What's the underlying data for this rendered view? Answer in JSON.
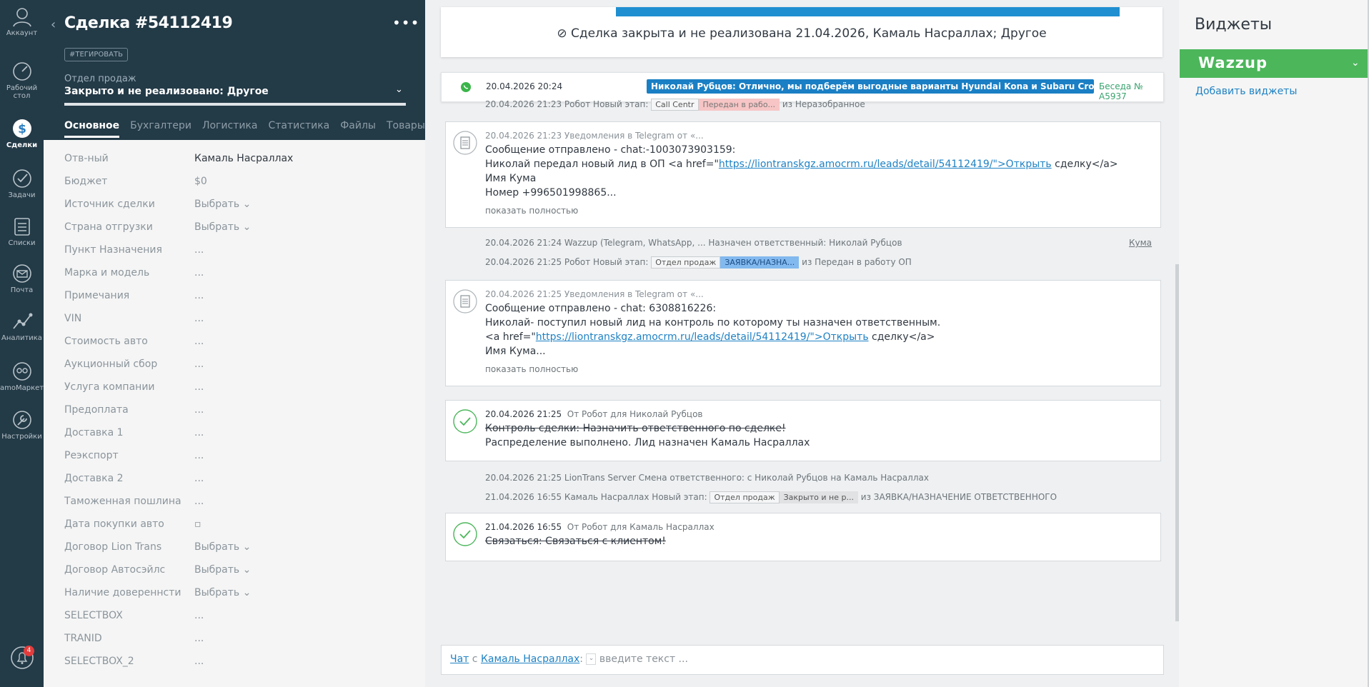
{
  "nav": {
    "items": [
      {
        "label": "Аккаунт",
        "icon": "account-icon"
      },
      {
        "label": "Рабочий стол",
        "icon": "dashboard-icon"
      },
      {
        "label": "Сделки",
        "icon": "deals-icon"
      },
      {
        "label": "Задачи",
        "icon": "tasks-icon"
      },
      {
        "label": "Списки",
        "icon": "lists-icon"
      },
      {
        "label": "Почта",
        "icon": "mail-icon"
      },
      {
        "label": "Аналитика",
        "icon": "analytics-icon"
      },
      {
        "label": "amoМаркет",
        "icon": "market-icon"
      },
      {
        "label": "Настройки",
        "icon": "settings-icon"
      }
    ],
    "notifications_count": "4"
  },
  "card": {
    "title": "Сделка #54112419",
    "tag_button": "#ТЕГИРОВАТЬ",
    "pipeline": "Отдел продаж",
    "status": "Закрыто и не реализовано: Другое",
    "tabs": [
      "Основное",
      "Бухгалтери",
      "Логистика",
      "Статистика",
      "Файлы",
      "Товары",
      "···"
    ],
    "fields": [
      {
        "label": "Отв-ный",
        "value": "Камаль Насраллах"
      },
      {
        "label": "Бюджет",
        "value": "$0"
      },
      {
        "label": "Источник сделки",
        "value": "Выбрать ⌄"
      },
      {
        "label": "Страна отгрузки",
        "value": "Выбрать ⌄"
      },
      {
        "label": "Пункт Назначения",
        "value": "..."
      },
      {
        "label": "Марка и модель",
        "value": "..."
      },
      {
        "label": "Примечания",
        "value": "..."
      },
      {
        "label": "VIN",
        "value": "..."
      },
      {
        "label": "Стоимость авто",
        "value": "..."
      },
      {
        "label": "Аукционный сбор",
        "value": "..."
      },
      {
        "label": "Услуга компании",
        "value": "..."
      },
      {
        "label": "Предоплата",
        "value": "..."
      },
      {
        "label": "Доставка 1",
        "value": "..."
      },
      {
        "label": "Реэкспорт",
        "value": "..."
      },
      {
        "label": "Доставка 2",
        "value": "..."
      },
      {
        "label": "Таможенная пошлина",
        "value": "..."
      },
      {
        "label": "Дата покупки авто",
        "value": "▫"
      },
      {
        "label": "Договор Lion Trans",
        "value": "Выбрать ⌄"
      },
      {
        "label": "Договор Автосэйлс",
        "value": "Выбрать ⌄"
      },
      {
        "label": "Наличие довереннсти",
        "value": "Выбрать ⌄"
      },
      {
        "label": "SELECTBOX",
        "value": "..."
      },
      {
        "label": "TRANID",
        "value": "..."
      },
      {
        "label": "SELECTBOX_2",
        "value": "..."
      }
    ]
  },
  "feed": {
    "closed_banner": "⊘  Сделка закрыта и не реализована 21.04.2026, Камаль Насраллах; Другое",
    "whatsapp": {
      "time": "20.04.2026 20:24",
      "message": "Николай Рубцов: Отличнo, мы подберём выгодные варианты Hyundai Kona и Subaru Crosstrek не старше ...",
      "conversation": "Беседа № A5937"
    },
    "sys1": {
      "text": "20.04.2026 21:23 Робот Новый этап:",
      "pill1": "Call Centr",
      "pill2": "Передан в рабо...",
      "suffix": "из Неразобранное"
    },
    "note1": {
      "meta": "20.04.2026 21:23 Уведомления в Telegram от «...",
      "l1": "Сообщение отправлено - chat:-1003073903159:",
      "l2_a": "Николай передал новый лид в ОП <a href=\"",
      "l2_link": "https://liontranskgz.amocrm.ru/leads/detail/54112419/\">Открыть",
      "l2_b": " сделку</a>",
      "l3": "Имя Кума",
      "l4": "Номер +996501998865...",
      "more": "показать полностью"
    },
    "sys2": {
      "text": "20.04.2026 21:24 Wazzup (Telegram, WhatsApp, ... Назначен ответственный: Николай Рубцов",
      "right": "Кума"
    },
    "sys3": {
      "text": "20.04.2026 21:25 Робот Новый этап:",
      "pill1": "Отдел продаж",
      "pill2": "ЗАЯВКА/НАЗНА...",
      "suffix": "из Передан в работу ОП"
    },
    "note2": {
      "meta": "20.04.2026 21:25 Уведомления в Telegram от «...",
      "l1": "Сообщение отправлено - chat: 6308816226:",
      "l2": "Николай- поступил новый лид на контроль по которому ты назначен ответственным.",
      "l3_a": "<a href=\"",
      "l3_link": "https://liontranskgz.amocrm.ru/leads/detail/54112419/\">Открыть",
      "l3_b": " сделку</a>",
      "l4": "Имя Кума...",
      "more": "показать полностью"
    },
    "task1": {
      "time": "20.04.2026 21:25",
      "meta": "От Робот для Николай Рубцов",
      "l1": "Контроль сделки: Назначить ответственного по сделке!",
      "l2": "Распределение выполнено. Лид назначен Камаль Насраллах"
    },
    "sys4": {
      "text": "20.04.2026 21:25 LionTrans Server Смена ответственного: с Николай Рубцов на Камаль Насраллах"
    },
    "sys5": {
      "text": "21.04.2026 16:55 Камаль Насраллах Новый этап:",
      "pill1": "Отдел продаж",
      "pill2": "Закрыто и не р...",
      "suffix": "из ЗАЯВКА/НАЗНАЧЕНИЕ ОТВЕТСТВЕННОГО"
    },
    "task2": {
      "time": "21.04.2026 16:55",
      "meta": "От Робот для Камаль Насраллах",
      "l1": "Связаться: Связаться с клиентом!"
    },
    "chat": {
      "prefix": "Чат",
      "with": " с ",
      "user": "Камаль Насраллах",
      "colon": ":",
      "placeholder": "введите текст ..."
    }
  },
  "widgets": {
    "title": "Виджеты",
    "wazzup": "Wazzup",
    "add": "Добавить виджеты"
  },
  "colors": {
    "nav_bg": "#233a47",
    "wazzup_green": "#4cb65b",
    "link_blue": "#1f82c4",
    "whatsapp_bubble": "#1a7fc4"
  }
}
